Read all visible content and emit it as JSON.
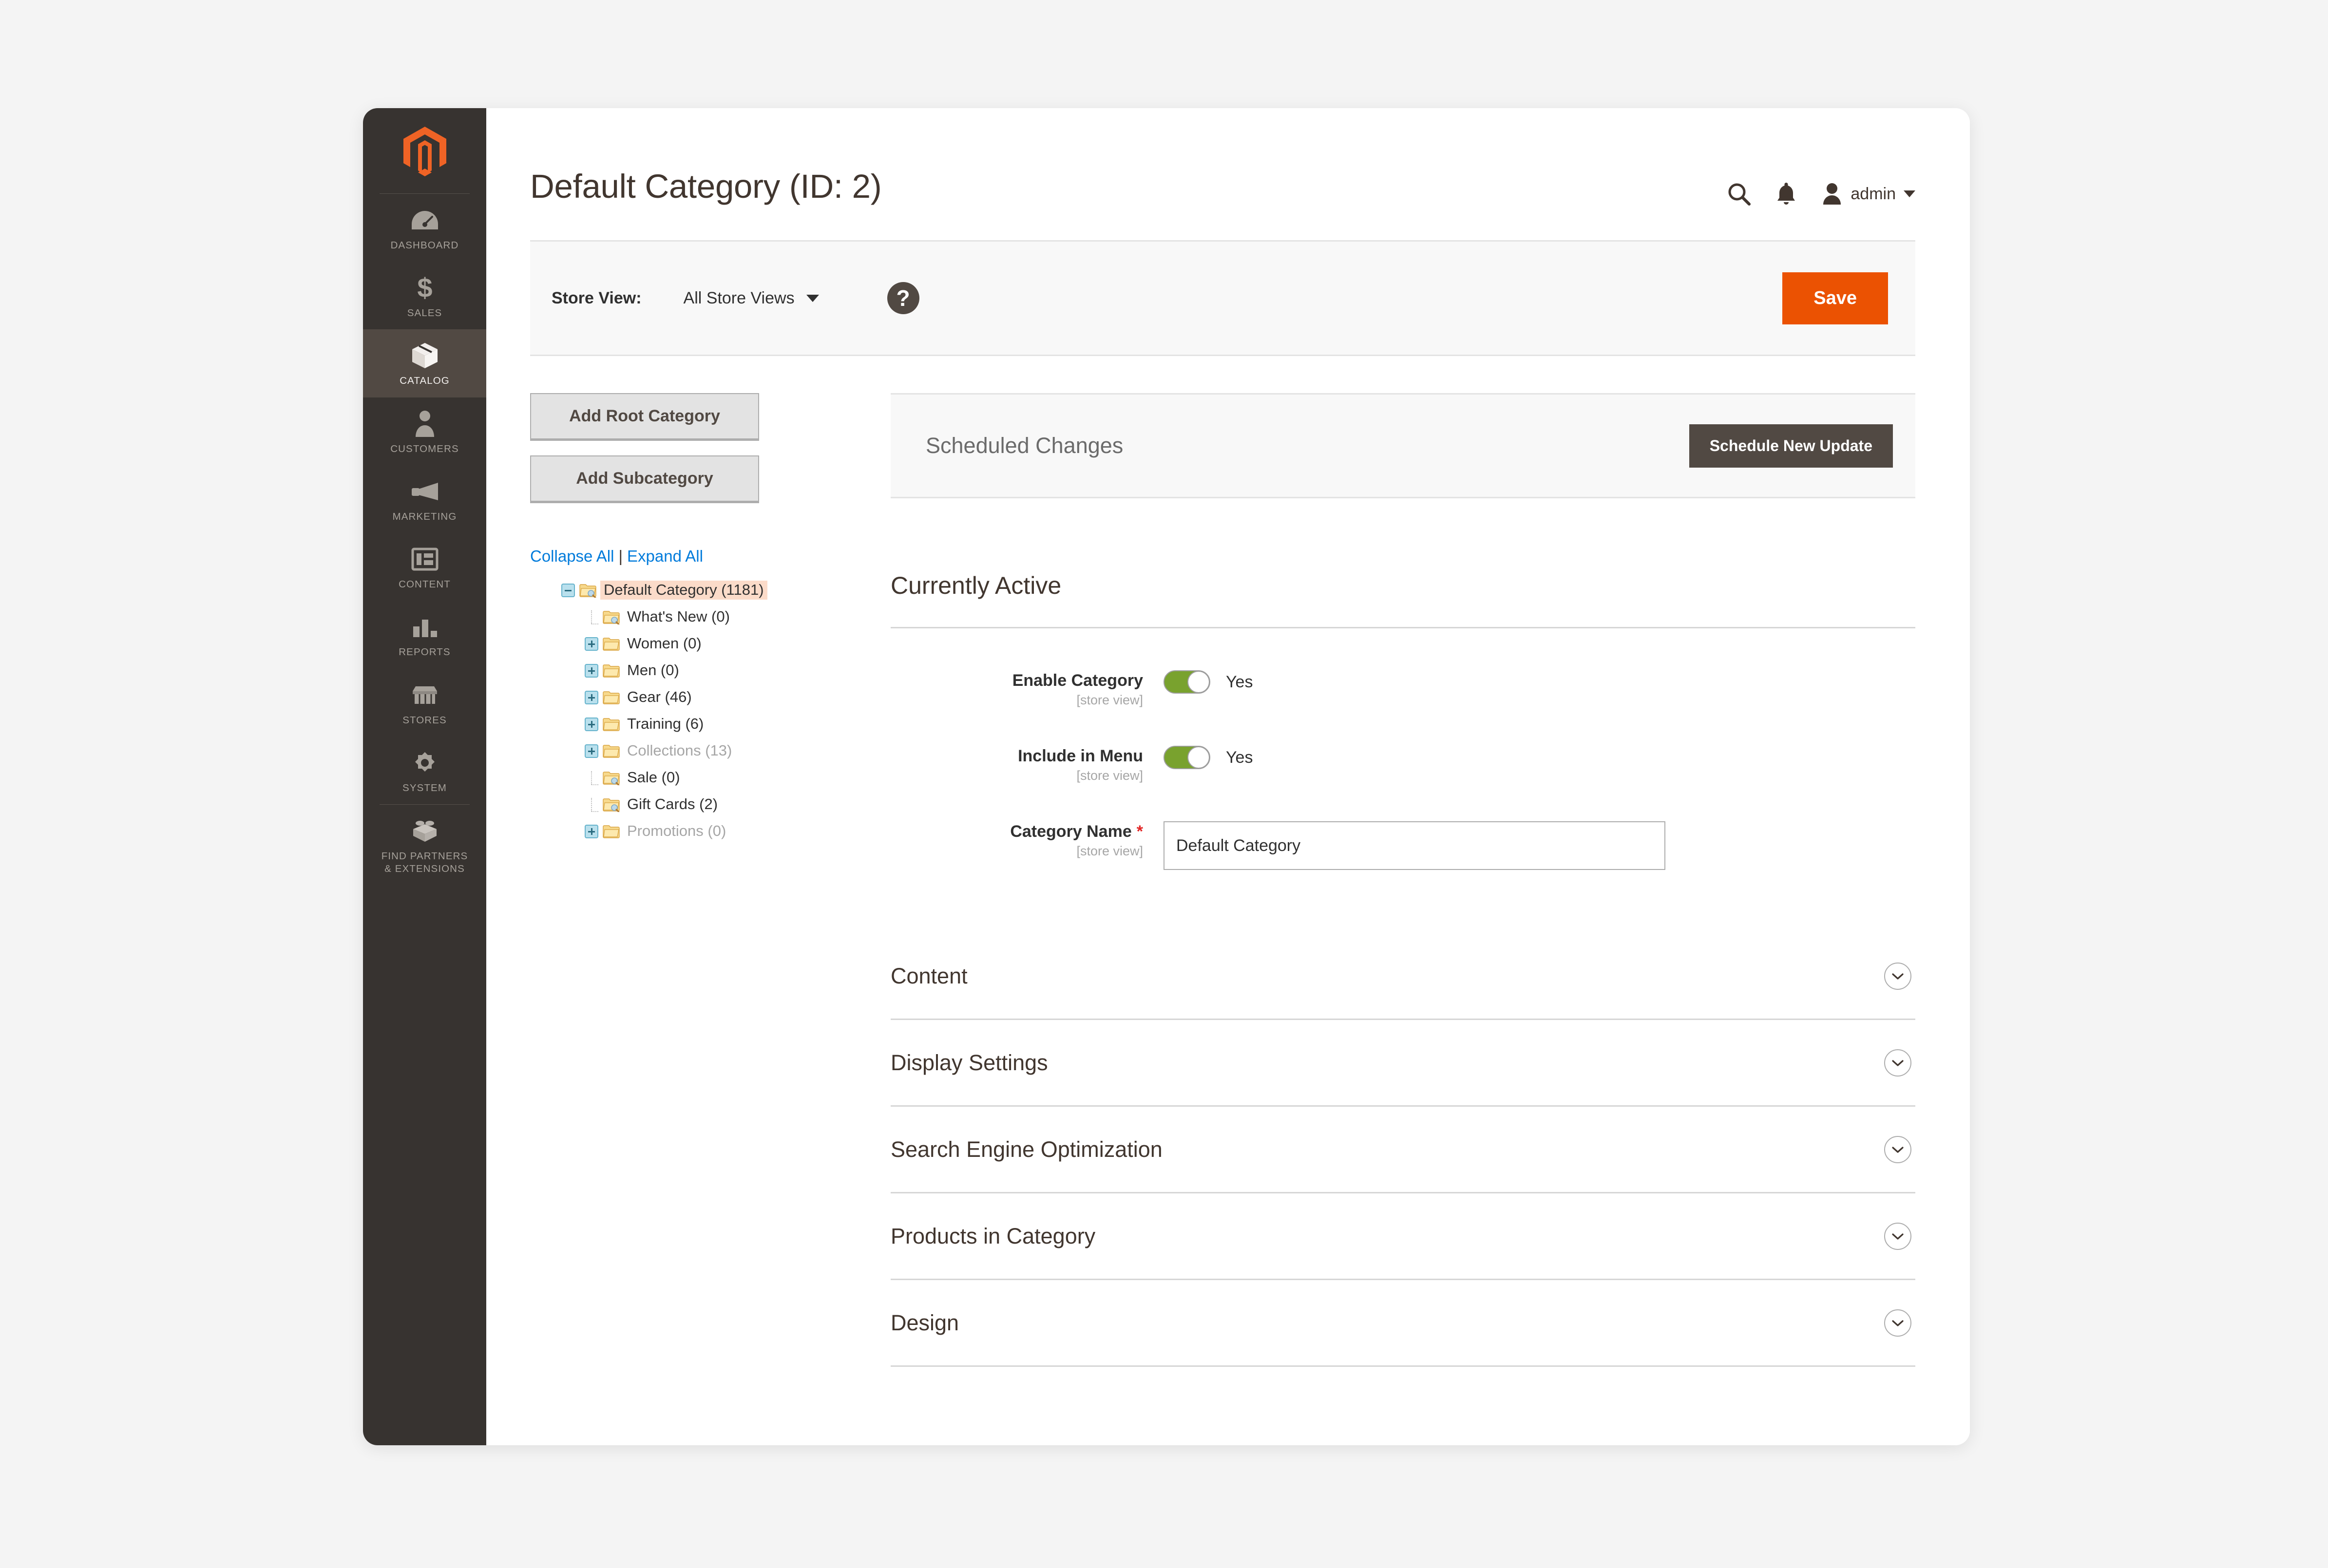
{
  "sidebar": {
    "logo_icon": "magento-logo-icon",
    "items": [
      {
        "label": "DASHBOARD",
        "icon": "dashboard-gauge-icon",
        "active": false
      },
      {
        "label": "SALES",
        "icon": "dollar-sign-icon",
        "active": false
      },
      {
        "label": "CATALOG",
        "icon": "box-cube-icon",
        "active": true
      },
      {
        "label": "CUSTOMERS",
        "icon": "person-icon",
        "active": false
      },
      {
        "label": "MARKETING",
        "icon": "megaphone-icon",
        "active": false
      },
      {
        "label": "CONTENT",
        "icon": "layout-window-icon",
        "active": false
      },
      {
        "label": "REPORTS",
        "icon": "bar-chart-icon",
        "active": false
      },
      {
        "label": "STORES",
        "icon": "storefront-awning-icon",
        "active": false
      },
      {
        "label": "SYSTEM",
        "icon": "gear-icon",
        "active": false
      },
      {
        "label": "FIND PARTNERS\n& EXTENSIONS",
        "icon": "lego-brick-icon",
        "active": false
      }
    ],
    "find_partners_line1": "FIND PARTNERS",
    "find_partners_line2": "& EXTENSIONS"
  },
  "header": {
    "title": "Default Category (ID: 2)",
    "search_icon": "search-icon",
    "notification_icon": "bell-icon",
    "avatar_icon": "user-avatar-icon",
    "admin_name": "admin"
  },
  "store_bar": {
    "label": "Store View:",
    "selected": "All Store Views",
    "help_icon": "question-mark-icon",
    "help_glyph": "?",
    "save_label": "Save"
  },
  "left_panel": {
    "add_root_label": "Add Root Category",
    "add_sub_label": "Add Subcategory",
    "collapse_all": "Collapse All",
    "expand_all": "Expand All",
    "separator": "|",
    "tree": [
      {
        "label": "Default Category (1181)",
        "level": 0,
        "toggle": "minus",
        "selected": true,
        "muted": false,
        "icon": "folder-search-icon"
      },
      {
        "label": "What's New (0)",
        "level": 1,
        "toggle": "none",
        "selected": false,
        "muted": false,
        "icon": "folder-search-icon"
      },
      {
        "label": "Women (0)",
        "level": 1,
        "toggle": "plus",
        "selected": false,
        "muted": false,
        "icon": "folder-icon"
      },
      {
        "label": "Men (0)",
        "level": 1,
        "toggle": "plus",
        "selected": false,
        "muted": false,
        "icon": "folder-icon"
      },
      {
        "label": "Gear (46)",
        "level": 1,
        "toggle": "plus",
        "selected": false,
        "muted": false,
        "icon": "folder-icon"
      },
      {
        "label": "Training (6)",
        "level": 1,
        "toggle": "plus",
        "selected": false,
        "muted": false,
        "icon": "folder-icon"
      },
      {
        "label": "Collections (13)",
        "level": 1,
        "toggle": "plus",
        "selected": false,
        "muted": true,
        "icon": "folder-icon"
      },
      {
        "label": "Sale (0)",
        "level": 1,
        "toggle": "none",
        "selected": false,
        "muted": false,
        "icon": "folder-search-icon"
      },
      {
        "label": "Gift Cards (2)",
        "level": 1,
        "toggle": "none",
        "selected": false,
        "muted": false,
        "icon": "folder-search-icon"
      },
      {
        "label": "Promotions (0)",
        "level": 1,
        "toggle": "plus",
        "selected": false,
        "muted": true,
        "icon": "folder-icon"
      }
    ]
  },
  "scheduled": {
    "title": "Scheduled Changes",
    "button_label": "Schedule New Update"
  },
  "currently_active": {
    "title": "Currently Active",
    "fields": [
      {
        "label": "Enable Category",
        "scope": "[store view]",
        "type": "toggle",
        "value": "Yes",
        "required": false
      },
      {
        "label": "Include in Menu",
        "scope": "[store view]",
        "type": "toggle",
        "value": "Yes",
        "required": false
      },
      {
        "label": "Category Name",
        "scope": "[store view]",
        "type": "text",
        "value": "Default Category",
        "required": true,
        "required_mark": "*"
      }
    ]
  },
  "sections": [
    {
      "label": "Content",
      "chevron": "chevron-down-icon"
    },
    {
      "label": "Display Settings",
      "chevron": "chevron-down-icon"
    },
    {
      "label": "Search Engine Optimization",
      "chevron": "chevron-down-icon"
    },
    {
      "label": "Products in Category",
      "chevron": "chevron-down-icon"
    },
    {
      "label": "Design",
      "chevron": "chevron-down-icon"
    }
  ],
  "colors": {
    "brand_orange": "#eb5202",
    "sidebar_bg": "#373330",
    "sidebar_active": "#514943",
    "toggle_on": "#79a22e",
    "link_blue": "#007bdb",
    "tree_selected_bg": "#fbdbc9",
    "required_red": "#e22626"
  }
}
